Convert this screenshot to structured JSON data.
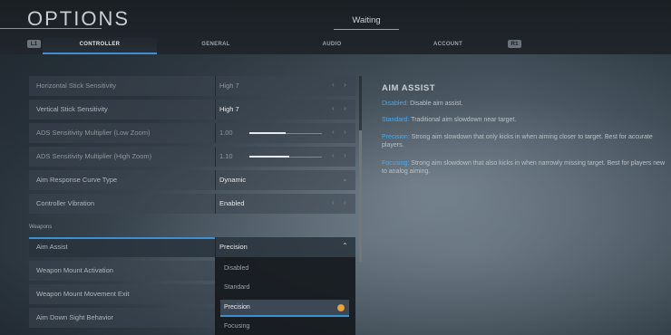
{
  "header": {
    "title": "OPTIONS",
    "status": "Waiting",
    "left_bumper": "L1",
    "right_bumper": "R1",
    "tabs": [
      {
        "label": "CONTROLLER",
        "active": true
      },
      {
        "label": "GENERAL",
        "active": false
      },
      {
        "label": "AUDIO",
        "active": false
      },
      {
        "label": "ACCOUNT",
        "active": false
      }
    ]
  },
  "settings": {
    "rows": [
      {
        "label": "Horizontal Stick Sensitivity",
        "value": "High 7"
      },
      {
        "label": "Vertical Stick Sensitivity",
        "value": "High 7"
      },
      {
        "label": "ADS Sensitivity Multiplier (Low Zoom)",
        "value": "1.00",
        "slider_fraction": 0.5
      },
      {
        "label": "ADS Sensitivity Multiplier (High Zoom)",
        "value": "1.10",
        "slider_fraction": 0.55
      },
      {
        "label": "Aim Response Curve Type",
        "value": "Dynamic"
      },
      {
        "label": "Controller Vibration",
        "value": "Enabled"
      }
    ],
    "section_label": "Weapons",
    "weapon_rows": [
      {
        "label": "Aim Assist",
        "value": "Precision"
      },
      {
        "label": "Weapon Mount Activation",
        "value": ""
      },
      {
        "label": "Weapon Mount Movement Exit",
        "value": ""
      },
      {
        "label": "Aim Down Sight Behavior",
        "value": ""
      }
    ]
  },
  "dropdown": {
    "options": [
      "Disabled",
      "Standard",
      "Precision",
      "Focusing"
    ],
    "selected": "Precision"
  },
  "info": {
    "title": "AIM ASSIST",
    "lines": [
      {
        "key": "Disabled:",
        "text": " Disable aim assist."
      },
      {
        "key": "Standard:",
        "text": " Traditional aim slowdown near target."
      },
      {
        "key": "Precision:",
        "text": " Strong aim slowdown that only kicks in when aiming closer to target.  Best for accurate players."
      },
      {
        "key": "Focusing:",
        "text": " Strong aim slowdown that also kicks in when narrowly missing target.  Best for players new to analog aiming."
      }
    ]
  },
  "colors": {
    "accent": "#3e8fd0",
    "key_text": "#4fa6e6",
    "radio": "#f2a23a"
  }
}
